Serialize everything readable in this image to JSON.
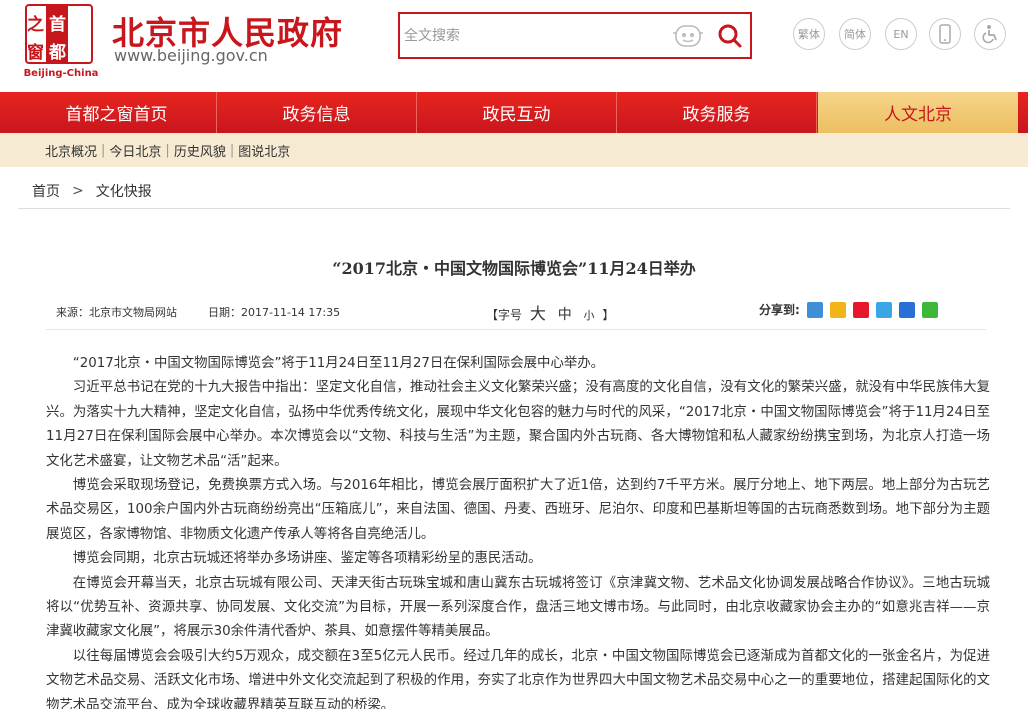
{
  "header": {
    "logo_chars": [
      "之",
      "首",
      "窗",
      "都"
    ],
    "logo_en": "Beijing-China",
    "site_title": "北京市人民政府",
    "site_url": "www.beijing.gov.cn",
    "search_placeholder": "全文搜索",
    "tools": [
      "繁体",
      "简体",
      "EN"
    ]
  },
  "nav": {
    "items": [
      "首都之窗首页",
      "政务信息",
      "政民互动",
      "政务服务",
      "人文北京"
    ]
  },
  "subnav": {
    "items": [
      "北京概况",
      "今日北京",
      "历史风貌",
      "图说北京"
    ]
  },
  "breadcrumb": {
    "home": "首页",
    "sep": ">",
    "current": "文化快报"
  },
  "article": {
    "title": "“2017北京・中国文物国际博览会”11月24日举办",
    "source": "来源：北京市文物局网站",
    "date": "日期：2017-11-14 17:35",
    "font_open": "【字号",
    "font_big": "大",
    "font_mid": "中",
    "font_small": "小",
    "font_close": "】",
    "share_label": "分享到:",
    "paragraphs": [
      "“2017北京・中国文物国际博览会”将于11月24日至11月27日在保利国际会展中心举办。",
      "习近平总书记在党的十九大报告中指出：坚定文化自信，推动社会主义文化繁荣兴盛；没有高度的文化自信，没有文化的繁荣兴盛，就没有中华民族伟大复兴。为落实十九大精神，坚定文化自信，弘扬中华优秀传统文化，展现中华文化包容的魅力与时代的风采，“2017北京・中国文物国际博览会”将于11月24日至11月27日在保利国际会展中心举办。本次博览会以“文物、科技与生活”为主题，聚合国内外古玩商、各大博物馆和私人藏家纷纷携宝到场，为北京人打造一场文化艺术盛宴，让文物艺术品“活”起来。",
      "博览会采取现场登记，免费换票方式入场。与2016年相比，博览会展厅面积扩大了近1倍，达到约7千平方米。展厅分地上、地下两层。地上部分为古玩艺术品交易区，100余户国内外古玩商纷纷亮出“压箱底儿”，来自法国、德国、丹麦、西班牙、尼泊尔、印度和巴基斯坦等国的古玩商悉数到场。地下部分为主题展览区，各家博物馆、非物质文化遗产传承人等将各自亮绝活儿。",
      "博览会同期，北京古玩城还将举办多场讲座、鉴定等各项精彩纷呈的惠民活动。",
      "在博览会开幕当天，北京古玩城有限公司、天津天街古玩珠宝城和唐山冀东古玩城将签订《京津冀文物、艺术品文化协调发展战略合作协议》。三地古玩城将以“优势互补、资源共享、协同发展、文化交流”为目标，开展一系列深度合作，盘活三地文博市场。与此同时，由北京收藏家协会主办的“如意兆吉祥——京津冀收藏家文化展”，将展示30余件清代香炉、茶具、如意摆件等精美展品。",
      "以往每届博览会会吸引大约5万观众，成交额在3至5亿元人民币。经过几年的成长，北京・中国文物国际博览会已逐渐成为首都文化的一张金名片，为促进文物艺术品交易、活跃文化市场、增进中外文化交流起到了积极的作用，夯实了北京作为世界四大中国文物艺术品交易中心之一的重要地位，搭建起国际化的文物艺术品交流平台、成为全球收藏界精英互联互动的桥梁。"
    ]
  },
  "colors": {
    "brand_red": "#c8161d",
    "nav_active_bg": "#ecbf61",
    "subnav_bg": "#f6ead2"
  }
}
